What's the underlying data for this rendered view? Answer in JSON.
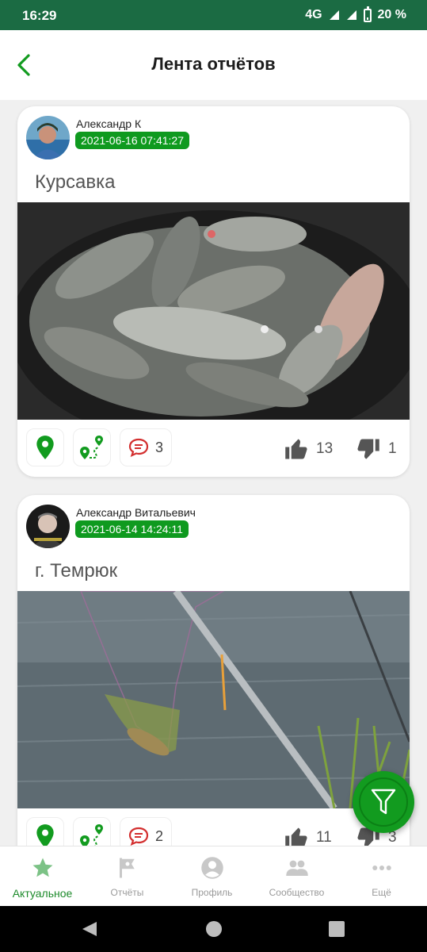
{
  "status_bar": {
    "time": "16:29",
    "network": "4G",
    "battery": "20 %"
  },
  "header": {
    "title": "Лента отчётов",
    "back_icon": "back-arrow-icon"
  },
  "colors": {
    "primary": "#129b1f",
    "status_bar": "#1b6b43",
    "date_badge": "#0f9a1f"
  },
  "feed": [
    {
      "author": "Александр К",
      "date": "2021-06-16 07:41:27",
      "place": "Курсавка",
      "comments": "3",
      "likes": "13",
      "dislikes": "1"
    },
    {
      "author": "Александр Витальевич",
      "date": "2021-06-14 14:24:11",
      "place": "г. Темрюк",
      "comments": "2",
      "likes": "11",
      "dislikes": "3"
    }
  ],
  "fab": {
    "icon": "filter-icon"
  },
  "bottom_nav": [
    {
      "label": "Актуальное",
      "icon": "star-icon",
      "active": true
    },
    {
      "label": "Отчёты",
      "icon": "flag-icon"
    },
    {
      "label": "Профиль",
      "icon": "account-icon"
    },
    {
      "label": "Сообщество",
      "icon": "group-icon"
    },
    {
      "label": "Ещё",
      "icon": "more-icon"
    }
  ]
}
